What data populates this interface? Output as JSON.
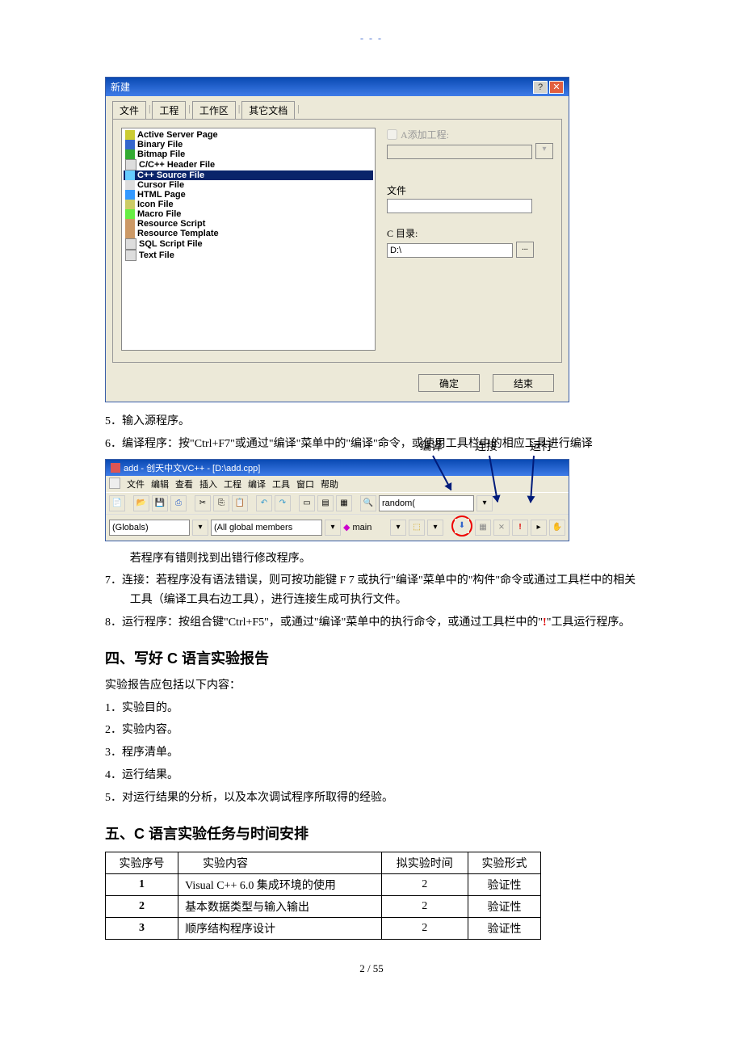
{
  "header_dashes": "- - -",
  "dialog": {
    "title": "新建",
    "tabs": [
      "文件",
      "工程",
      "工作区",
      "其它文档"
    ],
    "files": [
      "Active Server Page",
      "Binary File",
      "Bitmap File",
      "C/C++ Header File",
      "C++ Source File",
      "Cursor File",
      "HTML Page",
      "Icon File",
      "Macro File",
      "Resource Script",
      "Resource Template",
      "SQL Script File",
      "Text File"
    ],
    "selected_index": 4,
    "add_project_label": "A添加工程:",
    "file_label": "文件",
    "dir_label": "C 目录:",
    "dir_value": "D:\\",
    "ok": "确定",
    "cancel": "结束"
  },
  "steps": {
    "s5": "5．输入源程序。",
    "s6": "6．编译程序：按\"Ctrl+F7\"或通过\"编译\"菜单中的\"编译\"命令，或使用工具栏中的相应工具进行编译",
    "ann_compile": "编译",
    "ann_link": "连接",
    "ann_run": "运行",
    "err": "若程序有错则找到出错行修改程序。",
    "s7": "7．连接：若程序没有语法错误，则可按功能键 F 7 或执行\"编译\"菜单中的\"构件\"命令或通过工具栏中的相关工具（编译工具右边工具），进行连接生成可执行文件。",
    "s8a": "8．运行程序：按组合键\"Ctrl+F5\"，或通过\"编译\"菜单中的执行命令，或通过工具栏中的\"",
    "s8excl": "!",
    "s8b": "\"工具运行程序。"
  },
  "ide": {
    "title": "add - 创天中文VC++ - [D:\\add.cpp]",
    "menus": [
      "文件",
      "编辑",
      "查看",
      "插入",
      "工程",
      "编译",
      "工具",
      "窗口",
      "帮助"
    ],
    "combo_text": "random(",
    "globals": "(Globals)",
    "members": "(All global members",
    "main": "main"
  },
  "sec4": {
    "title": "四、写好 C 语言实验报告",
    "intro": "实验报告应包括以下内容：",
    "items": [
      "1．实验目的。",
      "2．实验内容。",
      "3．程序清单。",
      "4．运行结果。",
      "5．对运行结果的分析，以及本次调试程序所取得的经验。"
    ]
  },
  "sec5": {
    "title": "五、C 语言实验任务与时间安排",
    "headers": [
      "实验序号",
      "实验内容",
      "拟实验时间",
      "实验形式"
    ],
    "rows": [
      {
        "n": "1",
        "c": "Visual C++ 6.0 集成环境的使用",
        "t": "2",
        "f": "验证性"
      },
      {
        "n": "2",
        "c": "基本数据类型与输入输出",
        "t": "2",
        "f": "验证性"
      },
      {
        "n": "3",
        "c": "顺序结构程序设计",
        "t": "2",
        "f": "验证性"
      }
    ]
  },
  "pagenum": "2 / 55"
}
